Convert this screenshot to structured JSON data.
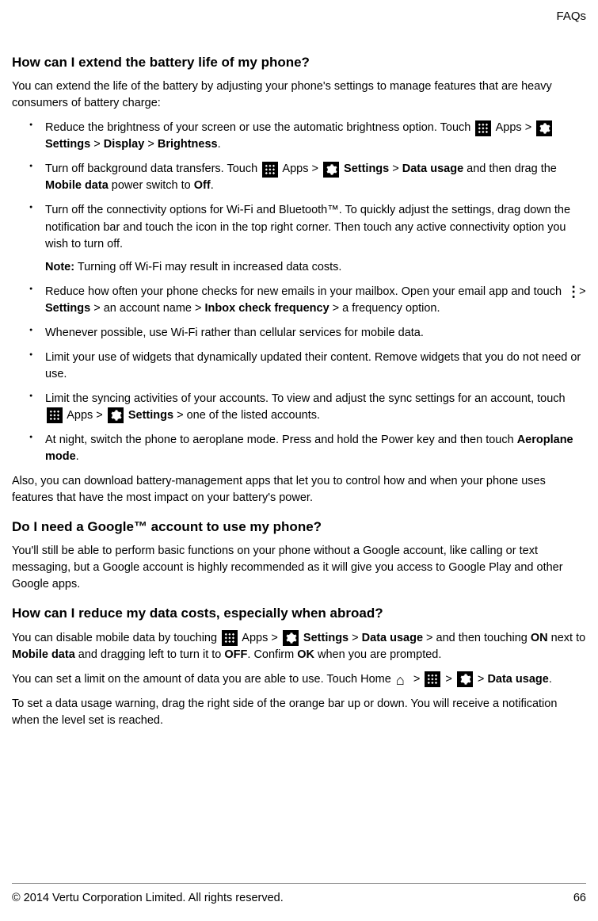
{
  "header": {
    "section": "FAQs"
  },
  "q1": {
    "title": "How can I extend the battery life of my phone?",
    "intro": "You can extend the life of the battery by adjusting your phone's settings to manage features that are heavy consumers of battery charge:",
    "b1": {
      "t1": "Reduce the brightness of your screen or use the automatic brightness option. Touch ",
      "apps": " Apps > ",
      "settings": "Settings",
      "gt1": " > ",
      "display": "Display",
      "gt2": " > ",
      "brightness": "Brightness",
      "dot": "."
    },
    "b2": {
      "t1": "Turn off background data transfers. Touch ",
      "apps": " Apps > ",
      "settings": "Settings",
      "gt1": " > ",
      "datausage": "Data usage",
      "t2": " and then drag the ",
      "mobiledata": "Mobile data",
      "t3": " power switch to ",
      "off": "Off",
      "dot": "."
    },
    "b3": {
      "t1": "Turn off the connectivity options for Wi-Fi and Bluetooth™. To quickly adjust the settings, drag down the notification bar and touch the icon in the top right corner. Then touch any active connectivity option you wish to turn off.",
      "noteLabel": "Note:",
      "noteText": " Turning off Wi-Fi may result in increased data costs."
    },
    "b4": {
      "t1": "Reduce how often your phone checks for new emails in your mailbox. Open your email app and touch ",
      "gt1": " > ",
      "settings": "Settings",
      "t2": " > an account name > ",
      "inbox": "Inbox check frequency",
      "t3": " > a frequency option."
    },
    "b5": {
      "t1": "Whenever possible, use Wi-Fi rather than cellular services for mobile data."
    },
    "b6": {
      "t1": "Limit your use of widgets that dynamically updated their content. Remove widgets that you do not need or use."
    },
    "b7": {
      "t1": "Limit the syncing activities of your accounts. To view and adjust the sync settings for an account, touch ",
      "apps": " Apps > ",
      "settings": "Settings",
      "t2": " >  one of the listed accounts."
    },
    "b8": {
      "t1": "At night, switch the phone to aeroplane mode. Press and hold the Power key and then touch ",
      "aero": "Aeroplane mode",
      "dot": "."
    },
    "outro": "Also, you can download battery-management apps that let you to control how and when your phone uses features that have the most impact on your battery's power."
  },
  "q2": {
    "title": "Do I need a Google™ account to use my phone?",
    "body": "You'll still be able to perform basic functions on your phone without a Google account, like calling or text messaging, but a Google account is highly recommended as it will give you access to Google Play and other Google apps."
  },
  "q3": {
    "title": "How can I reduce my data costs, especially when abroad?",
    "p1": {
      "t1": "You can disable mobile data by touching ",
      "apps": " Apps > ",
      "settings": "Settings",
      "gt1": " > ",
      "datausage": "Data usage",
      "t2": " > and then touching ",
      "on": "ON",
      "t3": " next to ",
      "mobiledata": "Mobile data",
      "t4": " and dragging left to turn it to ",
      "off": "OFF",
      "t5": ". Confirm ",
      "ok": "OK",
      "t6": " when you are prompted."
    },
    "p2": {
      "t1": "You can set a limit on the amount of data you are able to use. Touch Home ",
      "gt1": " > ",
      "gt2": " > ",
      "gt3": " > ",
      "datausage": "Data usage",
      "dot": "."
    },
    "p3": "To set a data usage warning, drag the right side of the orange bar up or down. You will receive a notification when the level set is reached."
  },
  "footer": {
    "copyright": "© 2014 Vertu Corporation Limited. All rights reserved.",
    "page": "66"
  }
}
